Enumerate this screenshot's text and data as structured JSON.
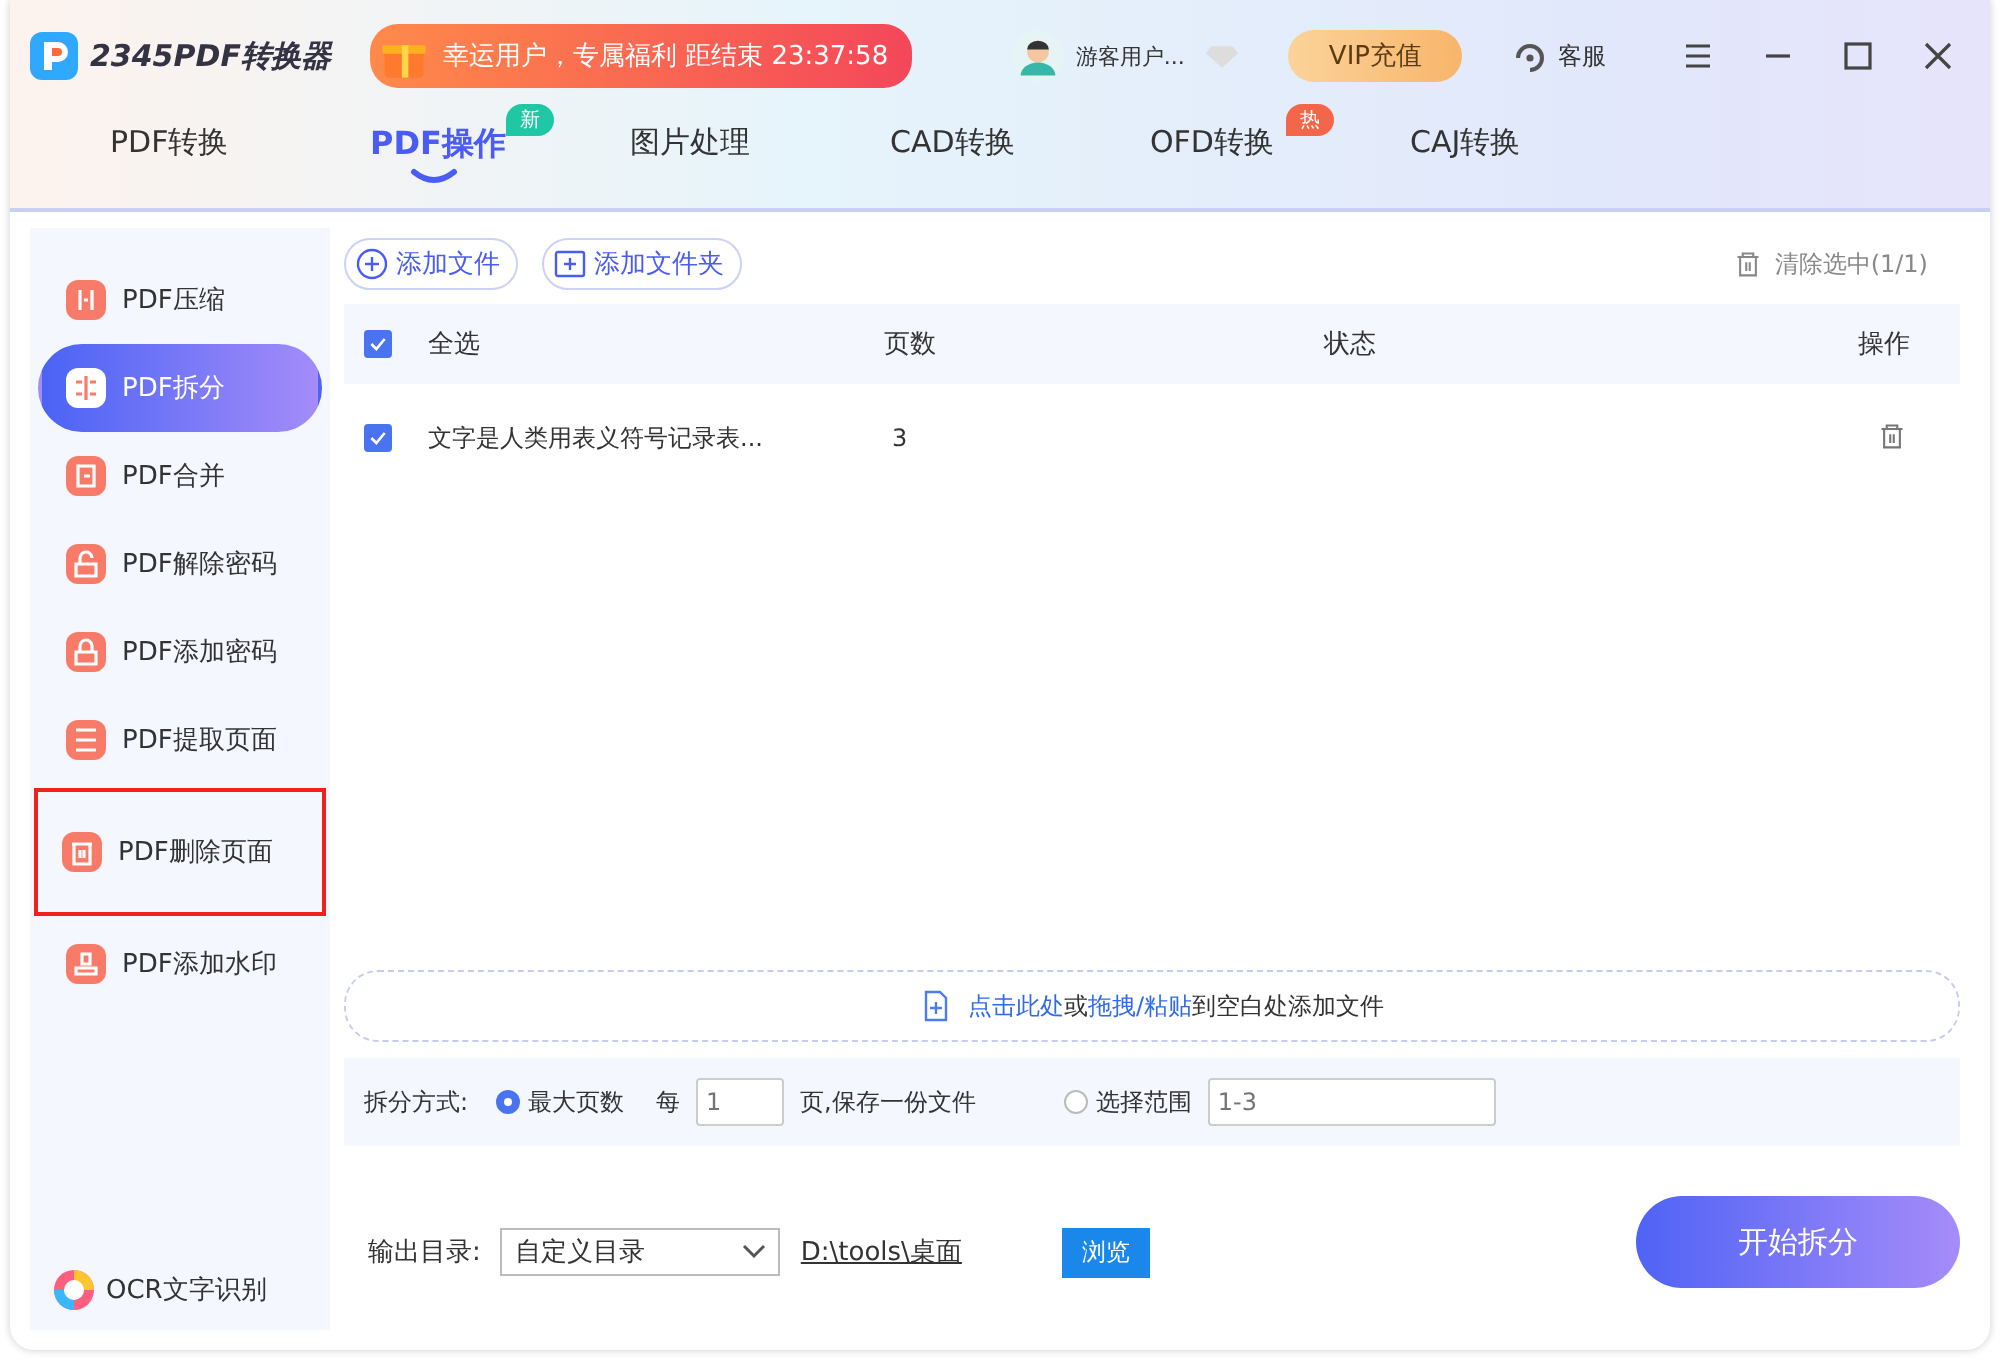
{
  "app": {
    "logo_text": "2345PDF转换器"
  },
  "promo": {
    "text": "幸运用户，专属福利 距结束 23:37:58"
  },
  "user": {
    "name": "游客用户..."
  },
  "vip_button": "VIP充值",
  "service": "客服",
  "tabs": [
    {
      "label": "PDF转换",
      "selected": false
    },
    {
      "label": "PDF操作",
      "selected": true,
      "badge": "新",
      "color": "#1fc7a4"
    },
    {
      "label": "图片处理",
      "selected": false
    },
    {
      "label": "CAD转换",
      "selected": false
    },
    {
      "label": "OFD转换",
      "selected": false,
      "badge": "热",
      "color": "#f4664a"
    },
    {
      "label": "CAJ转换",
      "selected": false
    }
  ],
  "sidebar": {
    "items": [
      {
        "label": "PDF压缩",
        "selected": false,
        "highlighted": false
      },
      {
        "label": "PDF拆分",
        "selected": true,
        "highlighted": false
      },
      {
        "label": "PDF合并",
        "selected": false,
        "highlighted": false
      },
      {
        "label": "PDF解除密码",
        "selected": false,
        "highlighted": false
      },
      {
        "label": "PDF添加密码",
        "selected": false,
        "highlighted": false
      },
      {
        "label": "PDF提取页面",
        "selected": false,
        "highlighted": false
      },
      {
        "label": "PDF删除页面",
        "selected": false,
        "highlighted": true
      },
      {
        "label": "PDF添加水印",
        "selected": false,
        "highlighted": false
      }
    ],
    "ocr": "OCR文字识别"
  },
  "toolbar": {
    "add_file": "添加文件",
    "add_folder": "添加文件夹",
    "clear": "清除选中(1/1)"
  },
  "table": {
    "select_all": {
      "label": "全选",
      "checked": true
    },
    "columns": [
      "页数",
      "状态",
      "操作"
    ],
    "rows": [
      {
        "checked": true,
        "name": "文字是人类用表义符号记录表...",
        "pages": "3"
      }
    ]
  },
  "dropzone": {
    "parts": [
      {
        "kind": "link",
        "text": "点击此处"
      },
      {
        "kind": "plain",
        "text": "或"
      },
      {
        "kind": "link",
        "text": "拖拽/粘贴"
      },
      {
        "kind": "plain",
        "text": "到空白处添加文件"
      }
    ]
  },
  "split": {
    "label": "拆分方式:",
    "options": [
      {
        "label": "最大页数",
        "selected": true
      },
      {
        "label": "选择范围",
        "selected": false
      }
    ],
    "each": "每",
    "pages_placeholder": "1",
    "suffix": "页,保存一份文件",
    "range_placeholder": "1-3"
  },
  "output": {
    "label": "输出目录:",
    "select": "自定义目录",
    "path": "D:\\tools\\桌面",
    "browse": "浏览"
  },
  "start_button": "开始拆分"
}
